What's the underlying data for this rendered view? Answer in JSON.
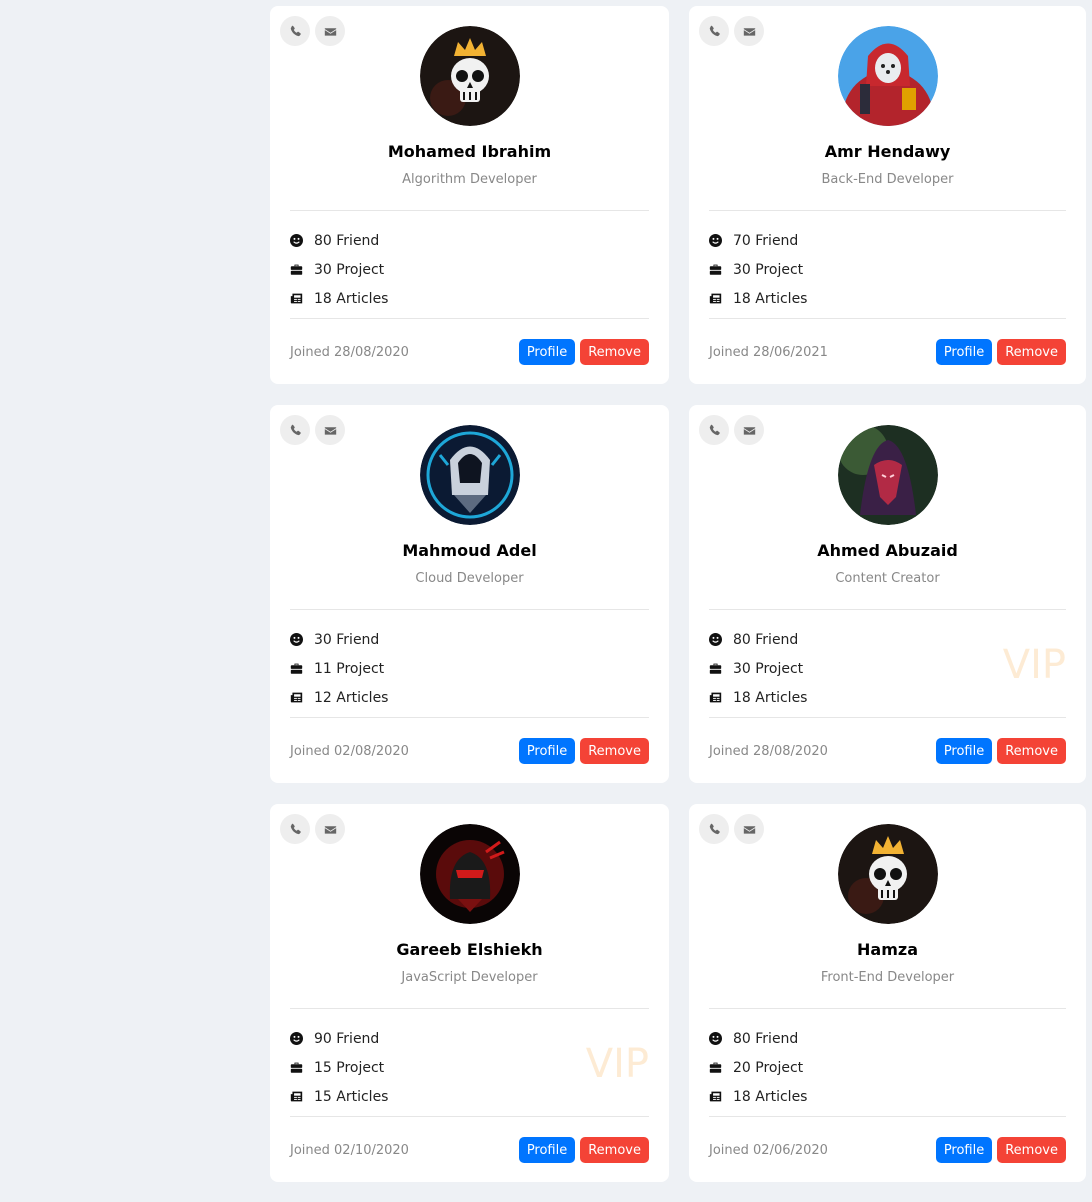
{
  "colors": {
    "page_bg": "#eef1f5",
    "card_bg": "#ffffff",
    "profile_button": "#0075ff",
    "remove_button": "#f44336",
    "vip_text": "#fdebd4"
  },
  "icons": {
    "phone": "phone-icon",
    "email": "envelope-icon",
    "friends": "smile-icon",
    "projects": "briefcase-icon",
    "articles": "newspaper-icon"
  },
  "cards": [
    {
      "name": "Mohamed Ibrahim",
      "role": "Algorithm Developer",
      "friends": "80 Friend",
      "projects": "30 Project",
      "articles": "18 Articles",
      "joined": "Joined 28/08/2020",
      "profile_label": "Profile",
      "remove_label": "Remove",
      "vip": "",
      "avatar": "skull-crown-avatar"
    },
    {
      "name": "Amr Hendawy",
      "role": "Back-End Developer",
      "friends": "70 Friend",
      "projects": "30 Project",
      "articles": "18 Articles",
      "joined": "Joined 28/06/2021",
      "profile_label": "Profile",
      "remove_label": "Remove",
      "vip": "",
      "avatar": "red-hooded-warrior-avatar"
    },
    {
      "name": "Mahmoud Adel",
      "role": "Cloud Developer",
      "friends": "30 Friend",
      "projects": "11 Project",
      "articles": "12 Articles",
      "joined": "Joined 02/08/2020",
      "profile_label": "Profile",
      "remove_label": "Remove",
      "vip": "",
      "avatar": "blue-hooded-assassin-avatar"
    },
    {
      "name": "Ahmed Abuzaid",
      "role": "Content Creator",
      "friends": "80 Friend",
      "projects": "30 Project",
      "articles": "18 Articles",
      "joined": "Joined 28/08/2020",
      "profile_label": "Profile",
      "remove_label": "Remove",
      "vip": "VIP",
      "avatar": "masked-figure-avatar"
    },
    {
      "name": "Gareeb Elshiekh",
      "role": "JavaScript Developer",
      "friends": "90 Friend",
      "projects": "15 Project",
      "articles": "15 Articles",
      "joined": "Joined 02/10/2020",
      "profile_label": "Profile",
      "remove_label": "Remove",
      "vip": "VIP",
      "avatar": "red-ninja-avatar"
    },
    {
      "name": "Hamza",
      "role": "Front-End Developer",
      "friends": "80 Friend",
      "projects": "20 Project",
      "articles": "18 Articles",
      "joined": "Joined 02/06/2020",
      "profile_label": "Profile",
      "remove_label": "Remove",
      "vip": "",
      "avatar": "skull-crown-avatar"
    }
  ]
}
